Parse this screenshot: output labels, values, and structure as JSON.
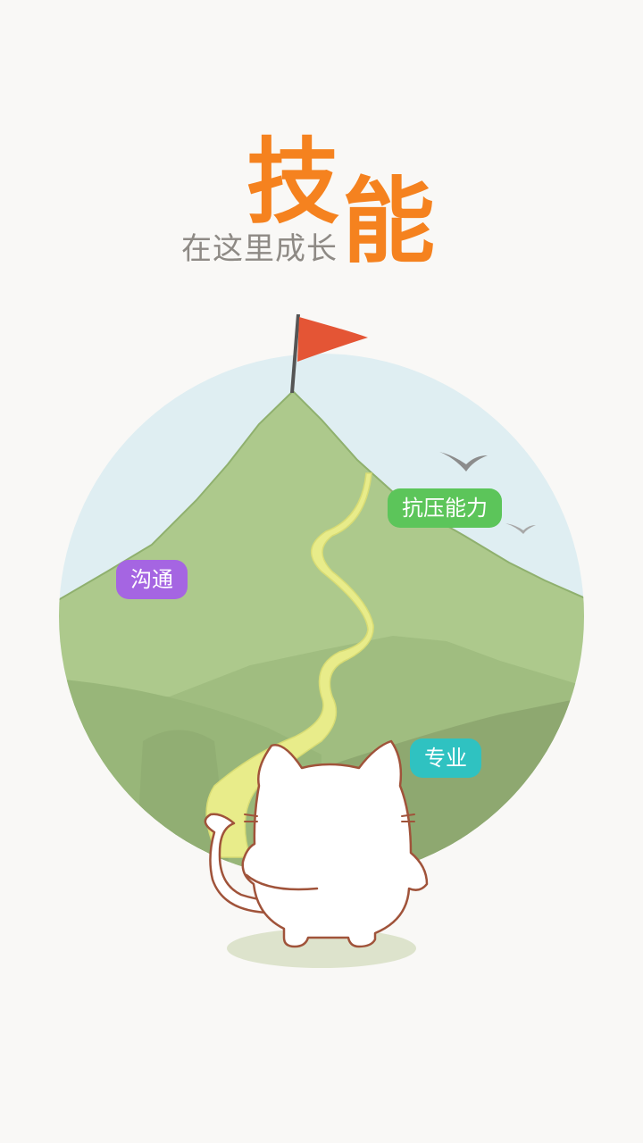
{
  "title": {
    "char_1": "技",
    "char_2": "能"
  },
  "subtitle": "在这里成长",
  "tags": {
    "communication": "沟通",
    "pressure_resistance": "抗压能力",
    "professional": "专业"
  },
  "colors": {
    "background": "#f9f8f6",
    "title_orange": "#f5821f",
    "sky": "#dfeef2",
    "mountain": "#adc98c",
    "flag": "#e45535",
    "tag_purple": "#a565e2",
    "tag_green": "#5cc55a",
    "tag_teal": "#2fc2c1"
  },
  "icons": [
    "flag-icon",
    "bird-icon",
    "cat-illustration"
  ]
}
